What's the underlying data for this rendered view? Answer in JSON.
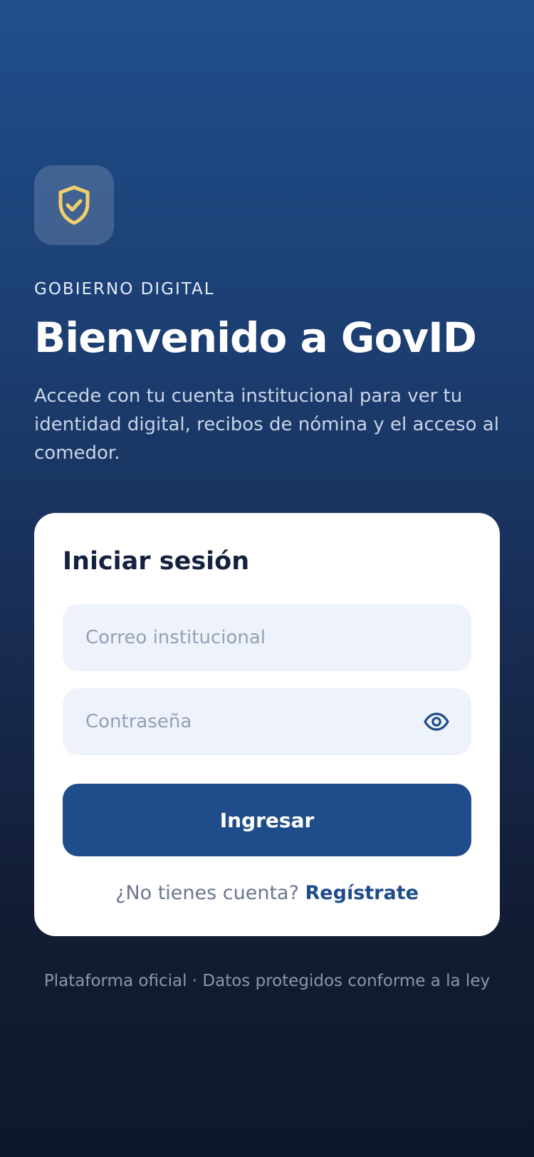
{
  "header": {
    "logo_icon": "shield-check-icon",
    "eyebrow": "GOBIERNO DIGITAL",
    "title": "Bienvenido a GovID",
    "subtitle": "Accede con tu cuenta institucional para ver tu identidad digital, recibos de nómina y el acceso al comedor."
  },
  "login": {
    "title": "Iniciar sesión",
    "email_placeholder": "Correo institucional",
    "password_placeholder": "Contraseña",
    "password_toggle_icon": "eye-icon",
    "submit_label": "Ingresar",
    "register_prompt": "¿No tienes cuenta?",
    "register_link": "Regístrate"
  },
  "footer": {
    "text": "Plataforma oficial · Datos protegidos conforme a la ley"
  },
  "colors": {
    "primary": "#1f4d8b",
    "accent_gold": "#f2cf6d",
    "background_top": "#1f4f8c",
    "background_bottom": "#0f172a",
    "input_bg": "#eef2fa"
  }
}
